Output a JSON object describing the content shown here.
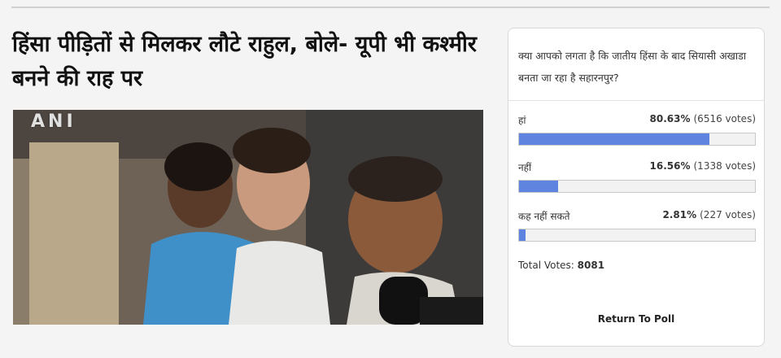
{
  "article": {
    "headline": "हिंसा पीड़ितों से मिलकर लौटे राहुल, बोले- यूपी भी कश्मीर बनने की राह पर",
    "photo_watermark": "ANI"
  },
  "poll": {
    "question": "क्या आपको लगता है कि जातीय हिंसा के बाद सियासी अखाडा बनता जा रहा है सहारनपुर?",
    "options": [
      {
        "label": "हां",
        "percent_text": "80.63%",
        "votes_text": "(6516 votes)",
        "fraction": 0.8063
      },
      {
        "label": "नहीं",
        "percent_text": "16.56%",
        "votes_text": "(1338 votes)",
        "fraction": 0.1656
      },
      {
        "label": "कह नहीं सकते",
        "percent_text": "2.81%",
        "votes_text": "(227 votes)",
        "fraction": 0.0281
      }
    ],
    "total_label": "Total Votes:",
    "total_value": "8081",
    "return_label": "Return To Poll",
    "bar_color": "#5e84e0"
  }
}
